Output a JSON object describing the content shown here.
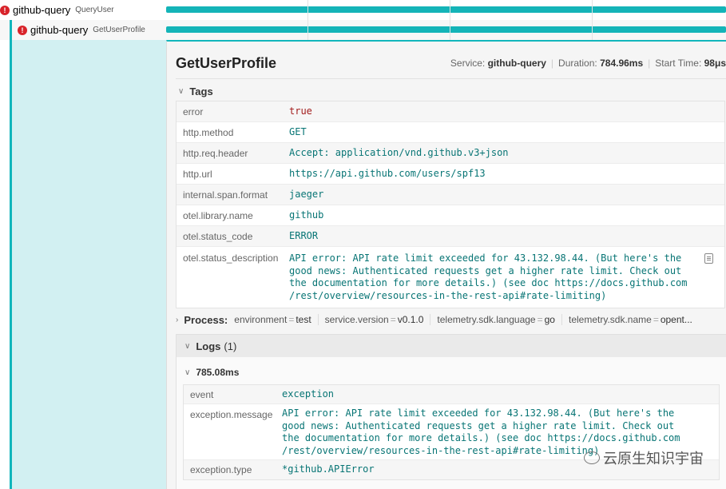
{
  "spans": [
    {
      "service": "github-query",
      "operation": "QueryUser"
    },
    {
      "service": "github-query",
      "operation": "GetUserProfile"
    }
  ],
  "header": {
    "title": "GetUserProfile",
    "service_label": "Service:",
    "service_value": "github-query",
    "duration_label": "Duration:",
    "duration_value": "784.96ms",
    "start_label": "Start Time:",
    "start_value": "98μs"
  },
  "tags": {
    "title": "Tags",
    "rows": [
      {
        "key": "error",
        "value": "true"
      },
      {
        "key": "http.method",
        "value": "GET"
      },
      {
        "key": "http.req.header",
        "value": "Accept: application/vnd.github.v3+json"
      },
      {
        "key": "http.url",
        "value": "https://api.github.com/users/spf13"
      },
      {
        "key": "internal.span.format",
        "value": "jaeger"
      },
      {
        "key": "otel.library.name",
        "value": "github"
      },
      {
        "key": "otel.status_code",
        "value": "ERROR"
      },
      {
        "key": "otel.status_description",
        "value": "API error: API rate limit exceeded for 43.132.98.44. (But here's the\ngood news: Authenticated requests get a higher rate limit. Check out\nthe documentation for more details.) (see doc https://docs.github.com\n/rest/overview/resources-in-the-rest-api#rate-limiting)"
      }
    ]
  },
  "process": {
    "label": "Process:",
    "items": [
      {
        "key": "environment",
        "value": "test"
      },
      {
        "key": "service.version",
        "value": "v0.1.0"
      },
      {
        "key": "telemetry.sdk.language",
        "value": "go"
      },
      {
        "key": "telemetry.sdk.name",
        "value": "opent..."
      }
    ]
  },
  "logs": {
    "title": "Logs",
    "count": "(1)",
    "entry_time": "785.08ms",
    "rows": [
      {
        "key": "event",
        "value": "exception"
      },
      {
        "key": "exception.message",
        "value": "API error: API rate limit exceeded for 43.132.98.44. (But here's the\ngood news: Authenticated requests get a higher rate limit. Check out\nthe documentation for more details.) (see doc https://docs.github.com\n/rest/overview/resources-in-the-rest-api#rate-limiting)"
      },
      {
        "key": "exception.type",
        "value": "*github.APIError"
      }
    ]
  },
  "watermark": "云原生知识宇宙",
  "colors": {
    "accent": "#11b6bc",
    "error": "#d8232a"
  }
}
